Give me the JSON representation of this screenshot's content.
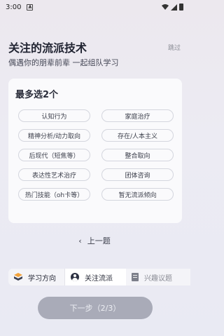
{
  "status_bar": {
    "time": "3:00",
    "notification_icon": "A"
  },
  "header": {
    "title": "关注的流派技术",
    "skip_label": "跳过",
    "subtitle": "偶遇你的朋辈前辈 一起组队学习"
  },
  "card": {
    "heading": "最多选2个",
    "tags": [
      "认知行为",
      "家庭治疗",
      "精神分析/动力取向",
      "存在/人本主义",
      "后现代（短焦等）",
      "整合取向",
      "表达性艺术治疗",
      "团体咨询",
      "热门技能（oh卡等）",
      "暂无流派倾向"
    ]
  },
  "nav": {
    "prev_label": "上一题",
    "prev_icon": "chevron-left-icon"
  },
  "steps": [
    {
      "label": "学习方向",
      "icon": "stack-icon",
      "state": "done"
    },
    {
      "label": "关注流派",
      "icon": "user-icon",
      "state": "current"
    },
    {
      "label": "兴趣议题",
      "icon": "list-icon",
      "state": "upcoming"
    }
  ],
  "footer": {
    "next_label": "下一步（2/3）"
  },
  "colors": {
    "button_disabled": "#a9abb8",
    "stack_icon_orange": "#f2a23a",
    "stack_icon_dark": "#3b4052"
  }
}
